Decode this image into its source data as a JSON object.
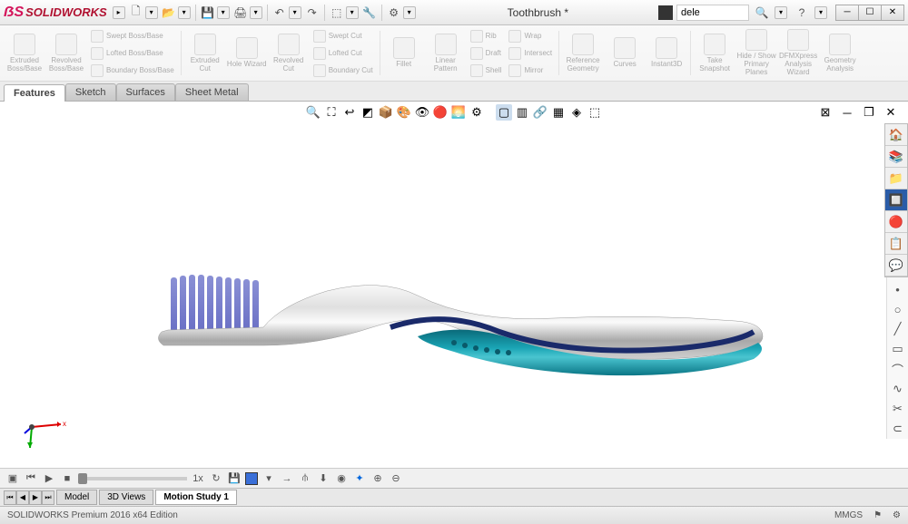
{
  "app": {
    "name": "SOLIDWORKS",
    "doc_title": "Toothbrush *"
  },
  "search": {
    "value": "dele"
  },
  "ribbon": {
    "extruded_boss": "Extruded Boss/Base",
    "revolved_boss": "Revolved Boss/Base",
    "swept_boss": "Swept Boss/Base",
    "lofted_boss": "Lofted Boss/Base",
    "boundary_boss": "Boundary Boss/Base",
    "extruded_cut": "Extruded Cut",
    "hole_wizard": "Hole Wizard",
    "revolved_cut": "Revolved Cut",
    "swept_cut": "Swept Cut",
    "lofted_cut": "Lofted Cut",
    "boundary_cut": "Boundary Cut",
    "fillet": "Fillet",
    "linear_pattern": "Linear Pattern",
    "rib": "Rib",
    "draft": "Draft",
    "shell": "Shell",
    "wrap": "Wrap",
    "intersect": "Intersect",
    "mirror": "Mirror",
    "ref_geom": "Reference Geometry",
    "curves": "Curves",
    "instant3d": "Instant3D",
    "take_snapshot": "Take Snapshot",
    "hide_show": "Hide / Show Primary Planes",
    "dfmxpress": "DFMXpress Analysis Wizard",
    "geom_analysis": "Geometry Analysis"
  },
  "cmd_tabs": [
    "Features",
    "Sketch",
    "Surfaces",
    "Sheet Metal"
  ],
  "cmd_tab_active": 0,
  "bottom_tabs": [
    "Model",
    "3D Views",
    "Motion Study 1"
  ],
  "bottom_tab_active": 2,
  "status": {
    "edition": "SOLIDWORKS Premium 2016 x64 Edition",
    "units": "MMGS"
  }
}
